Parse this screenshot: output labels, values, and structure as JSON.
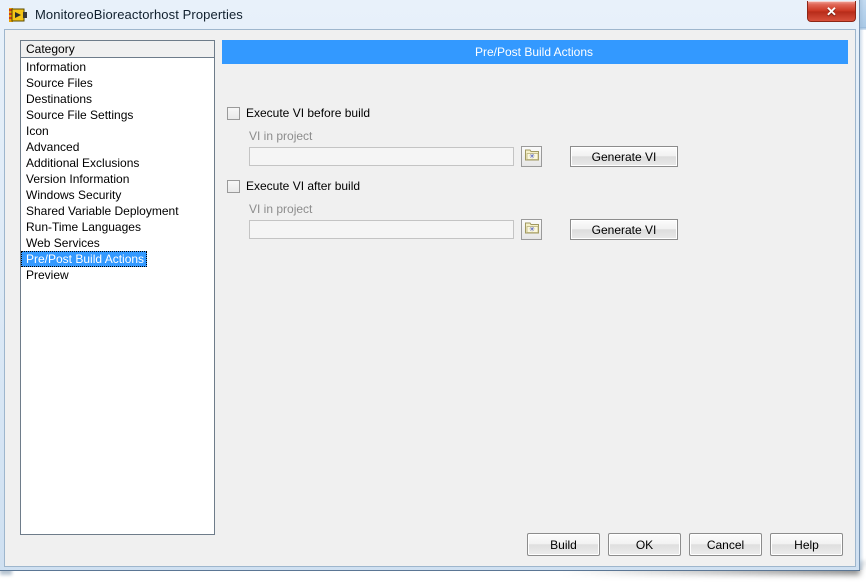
{
  "window": {
    "title": "MonitoreoBioreactorhost Properties",
    "app_icon": "labview-vi-icon",
    "close_label": "✕"
  },
  "category_panel": {
    "header": "Category",
    "selected": "Pre/Post Build Actions",
    "items": [
      {
        "label": "Information"
      },
      {
        "label": "Source Files"
      },
      {
        "label": "Destinations"
      },
      {
        "label": "Source File Settings"
      },
      {
        "label": "Icon"
      },
      {
        "label": "Advanced"
      },
      {
        "label": "Additional Exclusions"
      },
      {
        "label": "Version Information"
      },
      {
        "label": "Windows Security"
      },
      {
        "label": "Shared Variable Deployment"
      },
      {
        "label": "Run-Time Languages"
      },
      {
        "label": "Web Services"
      },
      {
        "label": "Pre/Post Build Actions"
      },
      {
        "label": "Preview"
      }
    ]
  },
  "main": {
    "header_title": "Pre/Post Build Actions",
    "before": {
      "checkbox_label": "Execute VI before build",
      "checked": false,
      "field_label": "VI in project",
      "field_value": "",
      "field_placeholder": "",
      "browse_icon": "folder-star-icon",
      "generate_label": "Generate  VI"
    },
    "after": {
      "checkbox_label": "Execute VI after build",
      "checked": false,
      "field_label": "VI in project",
      "field_value": "",
      "field_placeholder": "",
      "browse_icon": "folder-star-icon",
      "generate_label": "Generate  VI"
    }
  },
  "footer": {
    "buttons": [
      {
        "label": "Build"
      },
      {
        "label": "OK"
      },
      {
        "label": "Cancel"
      },
      {
        "label": "Help"
      }
    ]
  },
  "colors": {
    "accent_blue": "#3399ff",
    "dialog_face": "#f0f0f0",
    "close_red": "#c9331f",
    "disabled_text": "#8c8c8c"
  }
}
